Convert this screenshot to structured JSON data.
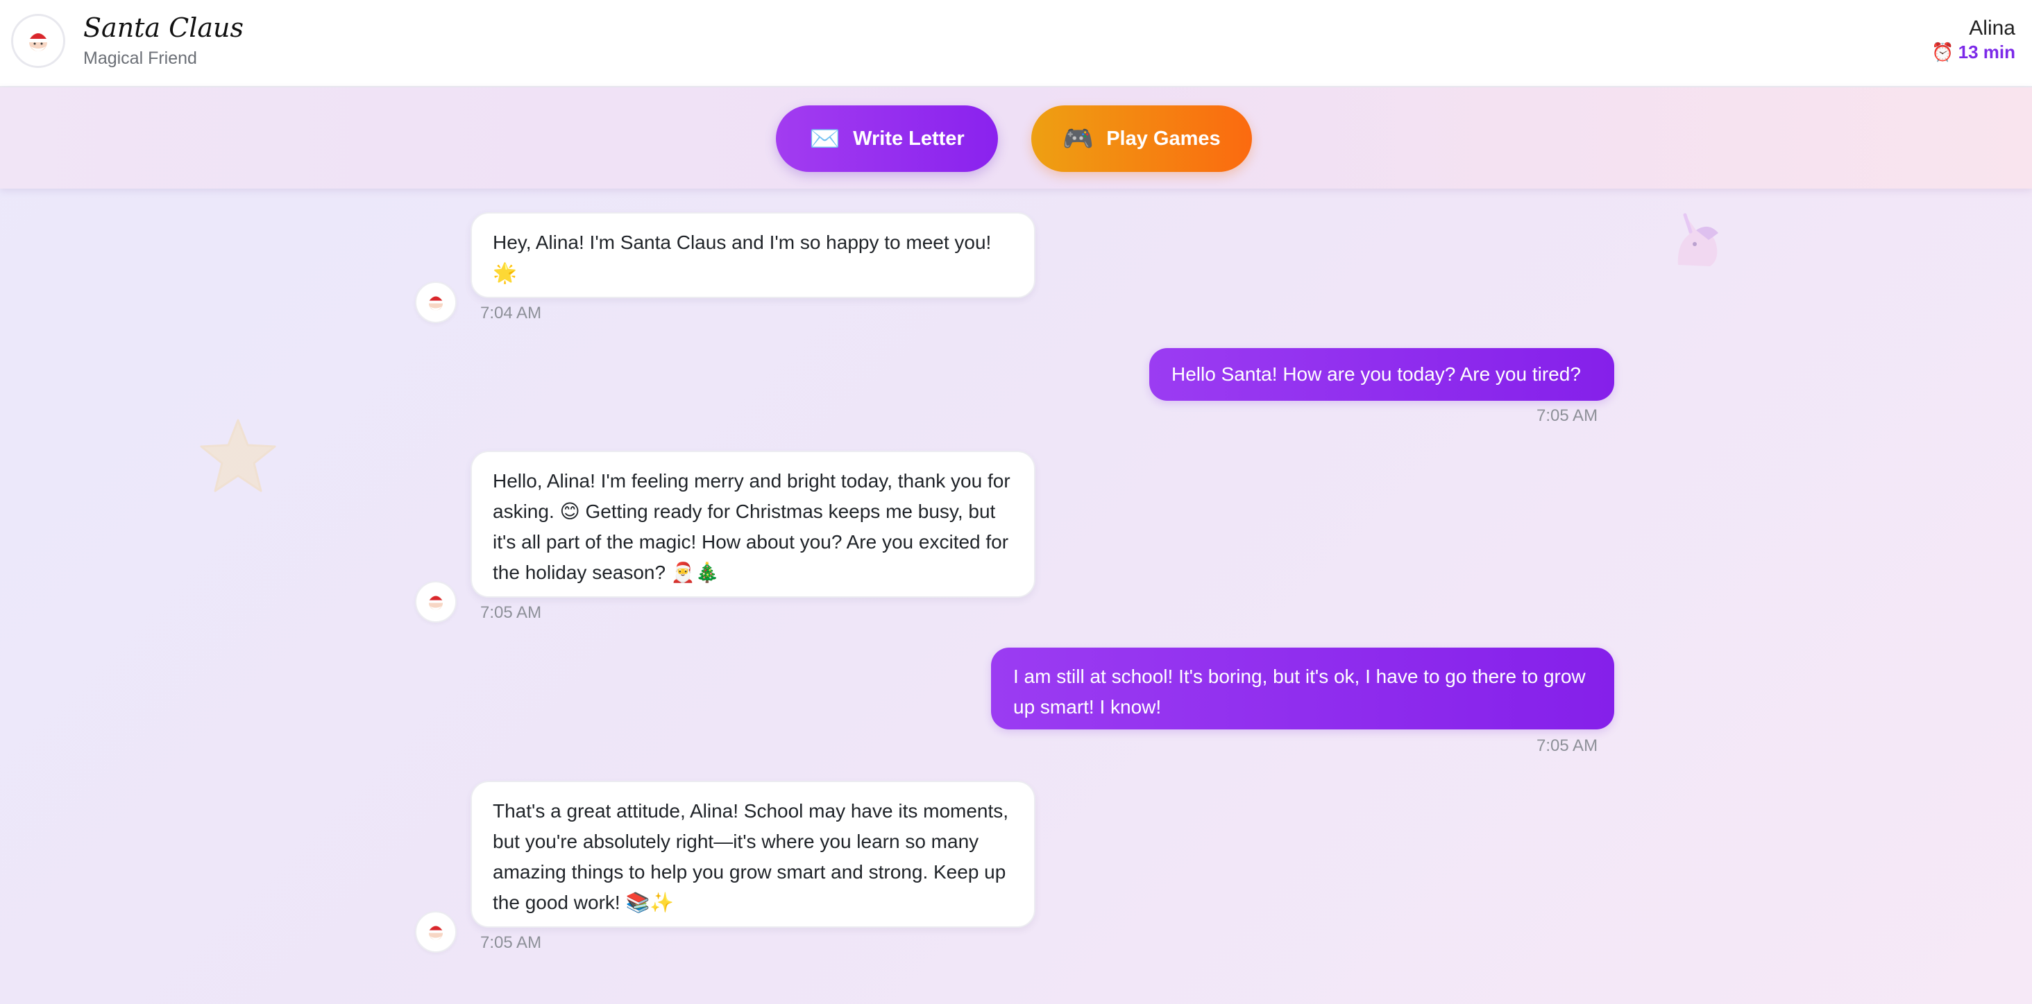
{
  "header": {
    "title": "Santa Claus",
    "subtitle": "Magical Friend",
    "user_name": "Alina",
    "timer_icon": "alarm-clock-icon",
    "timer_text": "13 min"
  },
  "actions": {
    "write_letter": {
      "label": "Write Letter",
      "icon": "envelope-icon",
      "glyph": "✉️"
    },
    "play_games": {
      "label": "Play Games",
      "icon": "gamepad-icon",
      "glyph": "🎮"
    }
  },
  "messages": [
    {
      "sender": "santa",
      "text": "Hey, Alina! I'm Santa Claus and I'm so happy to meet you! 🌟",
      "time": "7:04 AM"
    },
    {
      "sender": "user",
      "text": "Hello Santa! How are you today? Are you tired?",
      "time": "7:05 AM"
    },
    {
      "sender": "santa",
      "text": "Hello, Alina! I'm feeling merry and bright today, thank you for asking. 😊 Getting ready for Christmas keeps me busy, but it's all part of the magic! How about you? Are you excited for the holiday season? 🎅🎄",
      "time": "7:05 AM"
    },
    {
      "sender": "user",
      "text": "I am still at school! It's boring, but it's ok, I have to go there to grow up smart! I know!",
      "time": "7:05 AM"
    },
    {
      "sender": "santa",
      "text": "That's a great attitude, Alina! School may have its moments, but you're absolutely right—it's where you learn so many amazing things to help you grow smart and strong. Keep up the good work! 📚✨",
      "time": "7:05 AM"
    }
  ],
  "colors": {
    "accent_purple": "#8a22ee",
    "accent_orange": "#fb6a10",
    "timer_color": "#7c2ae8"
  }
}
